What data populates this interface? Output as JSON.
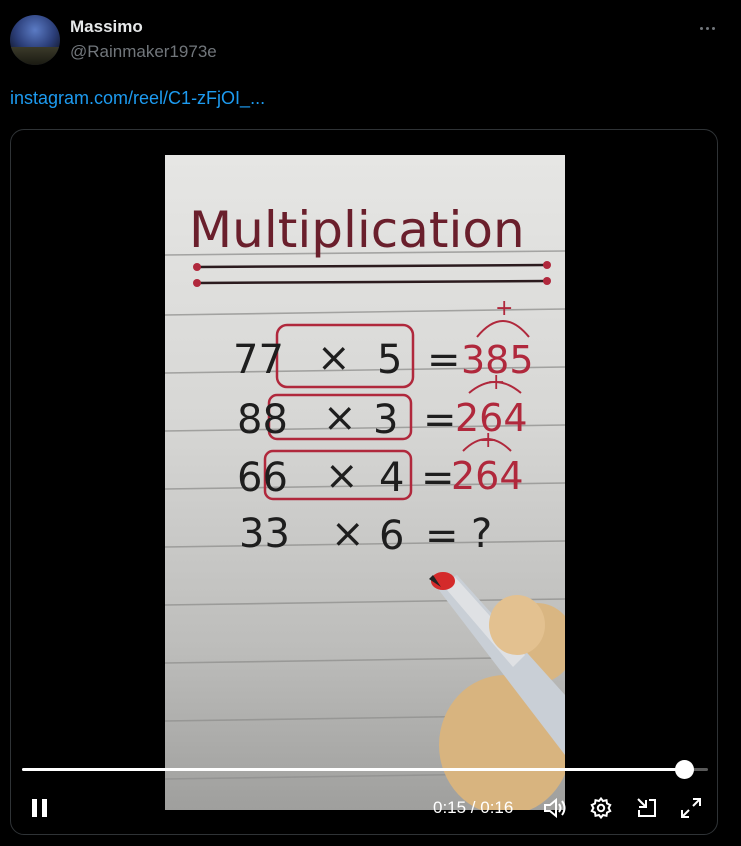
{
  "tweet": {
    "display_name": "Massimo",
    "handle": "@Rainmaker1973e",
    "link_text": "instagram.com/reel/C1-zFjOI_..."
  },
  "video": {
    "title": "Multiplication",
    "lines": [
      {
        "left": "77",
        "op": "×",
        "right": "5",
        "eq": "=",
        "result": "385"
      },
      {
        "left": "88",
        "op": "×",
        "right": "3",
        "eq": "=",
        "result": "264"
      },
      {
        "left": "66",
        "op": "×",
        "right": "4",
        "eq": "=",
        "result": "264"
      },
      {
        "left": "33",
        "op": "×",
        "right": "6",
        "eq": "=",
        "result": "?"
      }
    ],
    "plus_marks": [
      "+",
      "+",
      "+"
    ],
    "progress": 0.965
  },
  "controls": {
    "time": "0:15 / 0:16"
  },
  "icons": {
    "more": "more-icon",
    "pause": "pause-icon",
    "volume": "volume-icon",
    "settings": "gear-icon",
    "pip": "pip-icon",
    "fullscreen": "fullscreen-icon"
  },
  "colors": {
    "link": "#1d9bf0",
    "muted": "#71767b",
    "ink_red": "#b0283c"
  }
}
